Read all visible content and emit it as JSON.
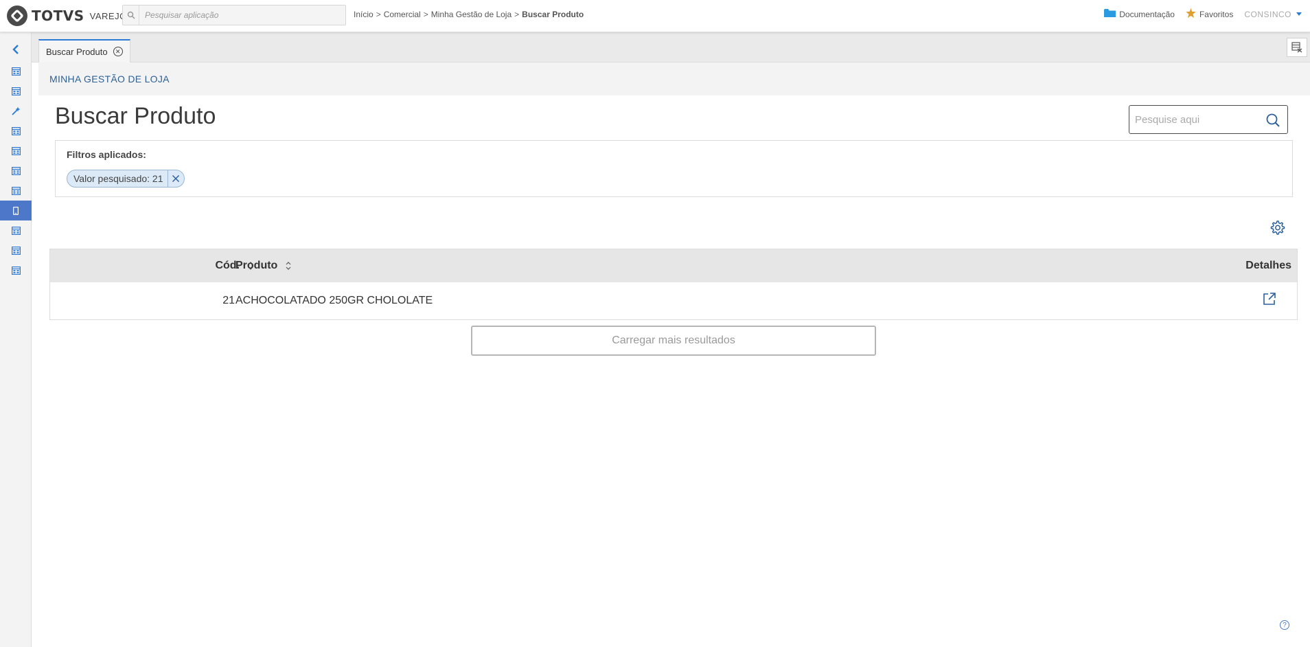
{
  "header": {
    "logo_text": "TOTVS",
    "logo_sub": "VAREJO",
    "search_placeholder": "Pesquisar aplicação",
    "breadcrumb": [
      "Início",
      "Comercial",
      "Minha Gestão de Loja",
      "Buscar Produto"
    ],
    "breadcrumb_sep": ">",
    "documentation_label": "Documentação",
    "favorites_label": "Favoritos",
    "user_label": "CONSINCO"
  },
  "sidebar": {
    "items": [
      {
        "icon": "table-icon",
        "active": false
      },
      {
        "icon": "table-icon",
        "active": false
      },
      {
        "icon": "wand-icon",
        "active": false
      },
      {
        "icon": "table-icon",
        "active": false
      },
      {
        "icon": "table-icon",
        "active": false
      },
      {
        "icon": "table-icon",
        "active": false
      },
      {
        "icon": "table-icon",
        "active": false
      },
      {
        "icon": "mobile-icon",
        "active": true
      },
      {
        "icon": "table-icon",
        "active": false
      },
      {
        "icon": "table-icon",
        "active": false
      },
      {
        "icon": "table-icon",
        "active": false
      }
    ]
  },
  "tabs": [
    {
      "label": "Buscar Produto"
    }
  ],
  "module": {
    "title": "MINHA GESTÃO DE LOJA"
  },
  "page": {
    "title": "Buscar Produto",
    "search_placeholder": "Pesquise aqui"
  },
  "filters": {
    "label": "Filtros aplicados:",
    "chips": [
      {
        "label": "Valor pesquisado: 21"
      }
    ]
  },
  "table": {
    "columns": {
      "cod": "Cód.",
      "produto": "Produto",
      "detalhes": "Detalhes"
    },
    "rows": [
      {
        "cod": "21",
        "produto": "ACHOCOLATADO 250GR CHOLOLATE"
      }
    ]
  },
  "load_more_label": "Carregar mais resultados",
  "colors": {
    "accent": "#2b7bd6",
    "sidebar_active": "#4d78c9",
    "module_title": "#2d5f95"
  }
}
